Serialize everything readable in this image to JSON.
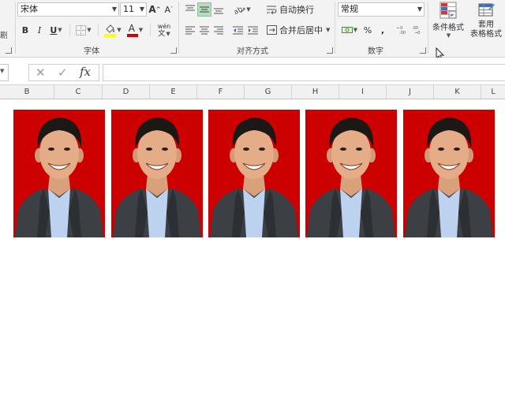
{
  "ribbon": {
    "font_group": {
      "font_name": "宋体",
      "font_size": "11",
      "label": "字体",
      "bold": "B",
      "italic": "I",
      "underline": "U",
      "phonetic": "wén",
      "increase_font": "A",
      "decrease_font": "A",
      "font_color": "A"
    },
    "align_group": {
      "wrap_text": "自动换行",
      "merge_center": "合并后居中",
      "label": "对齐方式"
    },
    "number_group": {
      "format": "常规",
      "percent": "%",
      "comma": ",",
      "label": "数字"
    },
    "styles_group": {
      "conditional_format": "条件格式",
      "table_format_line1": "套用",
      "table_format_line2": "表格格式"
    },
    "left_cut_label": "剧",
    "colors": {
      "active_align_bg": "#b6dcbd",
      "highlight": "#ffff00",
      "font_color": "#d00000"
    }
  },
  "formula_bar": {
    "cancel": "✕",
    "enter": "✓",
    "fx": "fx",
    "value": ""
  },
  "columns": [
    "B",
    "C",
    "D",
    "E",
    "F",
    "G",
    "H",
    "I",
    "J",
    "K",
    "L"
  ],
  "photos": {
    "count": 5,
    "background_color": "#cc0000"
  }
}
